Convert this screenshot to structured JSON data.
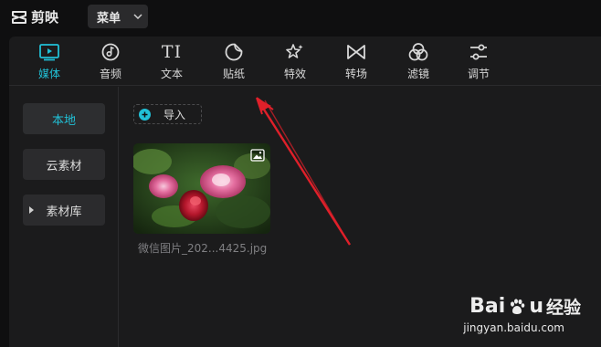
{
  "app": {
    "name": "剪映"
  },
  "menu": {
    "label": "菜单"
  },
  "toolbar": {
    "tabs": [
      {
        "label": "媒体",
        "icon": "media-icon",
        "active": true
      },
      {
        "label": "音频",
        "icon": "audio-icon",
        "active": false
      },
      {
        "label": "文本",
        "icon": "text-icon",
        "active": false
      },
      {
        "label": "贴纸",
        "icon": "sticker-icon",
        "active": false
      },
      {
        "label": "特效",
        "icon": "effects-icon",
        "active": false
      },
      {
        "label": "转场",
        "icon": "transition-icon",
        "active": false
      },
      {
        "label": "滤镜",
        "icon": "filter-icon",
        "active": false
      },
      {
        "label": "调节",
        "icon": "adjust-icon",
        "active": false
      }
    ],
    "text_icon_glyph": "TI"
  },
  "sidebar": {
    "items": [
      {
        "label": "本地",
        "active": true
      },
      {
        "label": "云素材",
        "active": false
      },
      {
        "label": "素材库",
        "active": false,
        "expandable": true
      }
    ]
  },
  "content": {
    "import_label": "导入",
    "media": [
      {
        "filename": "微信图片_202...4425.jpg"
      }
    ]
  },
  "colors": {
    "accent": "#21c0d6",
    "annotation_arrow": "#e0202a",
    "panel_bg": "#1b1b1c"
  },
  "watermark": {
    "brand_latin": "Bai",
    "brand_latin_tail": "u",
    "brand_cn": "经验",
    "url": "jingyan.baidu.com"
  }
}
